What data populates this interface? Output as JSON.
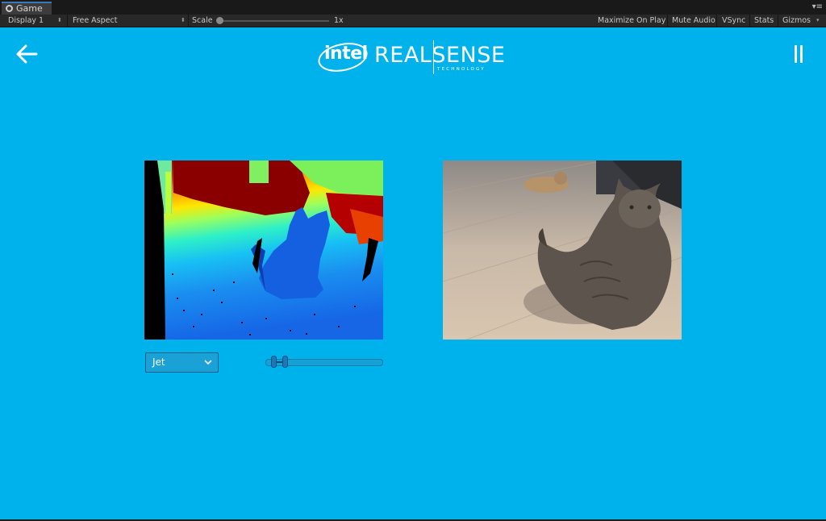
{
  "editor": {
    "tab_label": "Game",
    "display_label": "Display 1",
    "aspect_label": "Free Aspect",
    "scale_label": "Scale",
    "scale_value": "1x",
    "maximize_label": "Maximize On Play",
    "mute_label": "Mute Audio",
    "vsync_label": "VSync",
    "stats_label": "Stats",
    "gizmos_label": "Gizmos"
  },
  "app": {
    "logo_intel": "intel",
    "logo_realsense": "REALSENSE",
    "logo_tagline": "TECHNOLOGY",
    "colormap": {
      "selected": "Jet"
    },
    "depth_range": {
      "min_fraction": 0.05,
      "max_fraction": 0.15
    }
  },
  "colors": {
    "game_background": "#00b2ec",
    "editor_dark": "#282828"
  },
  "icons": {
    "back": "back-arrow-icon",
    "pause": "pause-icon",
    "dropdown": "chevron-down-icon"
  }
}
